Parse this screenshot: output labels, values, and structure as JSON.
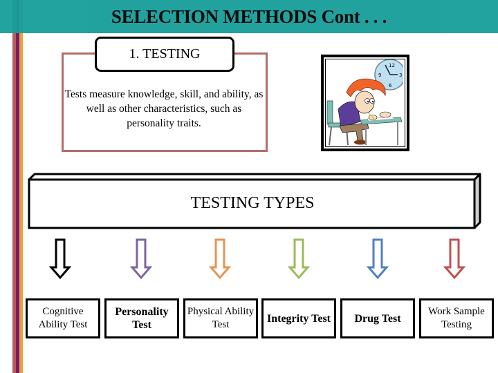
{
  "slide": {
    "title": "SELECTION METHODS Cont . . .",
    "colors": {
      "header": "#169e9a",
      "stripe_red": "#b85c5c",
      "stripe_purple": "#7a1a6e",
      "stripe_orange": "#e8a23a",
      "definition_border": "#b56b6b"
    }
  },
  "section": {
    "label": "1. TESTING",
    "definition": "Tests measure knowledge, skill, and ability, as well as other characteristics, such as personality traits."
  },
  "illustration": {
    "description": "student-taking-test-with-clock",
    "clock_numbers": [
      "12",
      "3",
      "6",
      "9"
    ]
  },
  "testing_types": {
    "heading": "TESTING TYPES",
    "items": [
      {
        "label": "Cognitive Ability Test",
        "arrow_color": "#000000",
        "bold": false
      },
      {
        "label": "Personality Test",
        "arrow_color": "#7d64a0",
        "bold": true
      },
      {
        "label": "Physical Ability Test",
        "arrow_color": "#e6944f",
        "bold": false
      },
      {
        "label": "Integrity Test",
        "arrow_color": "#9bbb59",
        "bold": true
      },
      {
        "label": "Drug Test",
        "arrow_color": "#4f81bd",
        "bold": true
      },
      {
        "label": "Work Sample Testing",
        "arrow_color": "#c0504d",
        "bold": false
      }
    ]
  }
}
